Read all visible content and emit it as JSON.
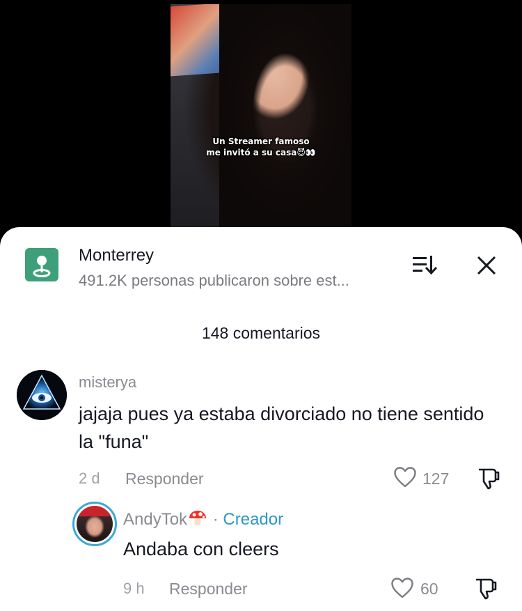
{
  "video": {
    "caption_line1": "Un Streamer famoso",
    "caption_line2": "me invitó a su casa😈👀"
  },
  "location": {
    "name": "Monterrey",
    "subtitle": "491.2K personas publicaron sobre est...",
    "icon": "location-pin-icon",
    "icon_bg": "#3ea07a"
  },
  "comments_count": "148 comentarios",
  "comments": [
    {
      "user": "misterya",
      "text": "jajaja pues ya estaba divorciado no tiene sentido la \"funa\"",
      "time": "2 d",
      "reply_label": "Responder",
      "likes": "127"
    },
    {
      "user": "AndyTok",
      "badge_sep": " · ",
      "badge": "Creador",
      "text": "Andaba con cleers",
      "time": "9 h",
      "reply_label": "Responder",
      "likes": "60"
    }
  ],
  "colors": {
    "creator_badge": "#2f97c7",
    "avatar_ring": "#3aa8d8"
  }
}
